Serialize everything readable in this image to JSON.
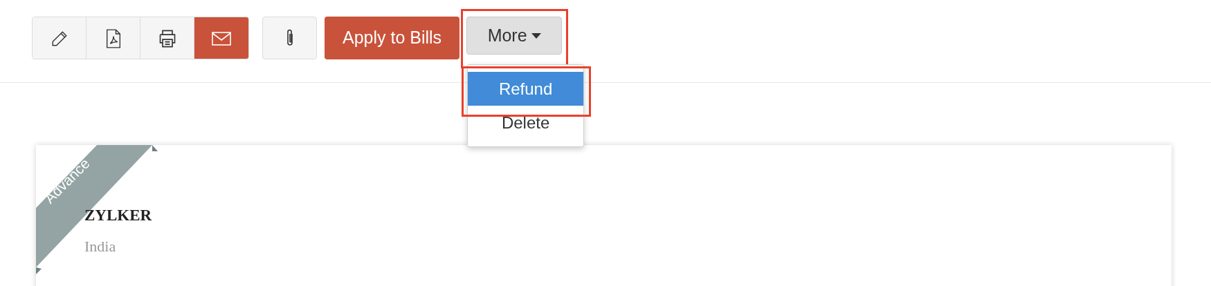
{
  "toolbar": {
    "apply_button": "Apply to Bills",
    "more_button": {
      "label": "More",
      "open": true
    }
  },
  "more_menu": [
    {
      "label": "Refund",
      "selected": true
    },
    {
      "label": "Delete",
      "selected": false
    }
  ],
  "document": {
    "ribbon": "Advance",
    "company": "ZYLKER",
    "country": "India"
  }
}
